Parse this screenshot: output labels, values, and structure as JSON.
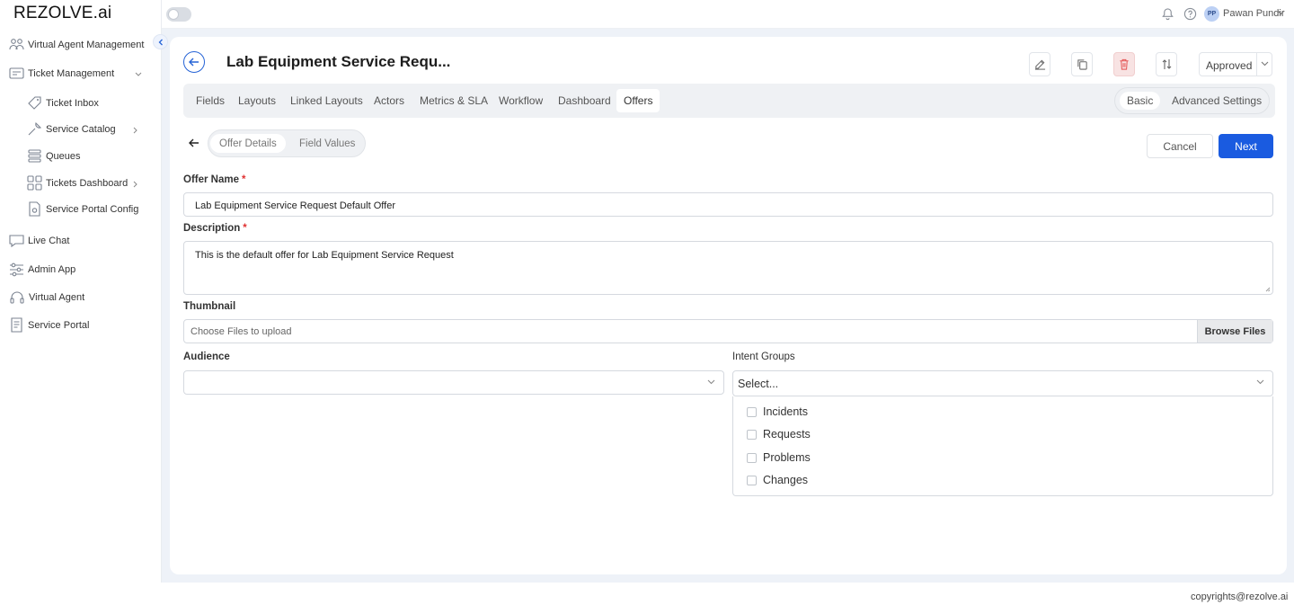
{
  "app": {
    "logo": "REZOLVE.ai"
  },
  "topbar": {
    "user_initials": "PP",
    "user_name": "Pawan Pundir"
  },
  "sidebar": {
    "items": [
      {
        "label": "Virtual Agent Management",
        "icon": "people-icon"
      },
      {
        "label": "Ticket Management",
        "icon": "ticket-board-icon"
      },
      {
        "label": "Ticket Inbox",
        "icon": "tag-icon"
      },
      {
        "label": "Service Catalog",
        "icon": "wrench-icon"
      },
      {
        "label": "Queues",
        "icon": "stack-icon"
      },
      {
        "label": "Tickets Dashboard",
        "icon": "grid-icon"
      },
      {
        "label": "Service Portal Config",
        "icon": "file-gear-icon"
      },
      {
        "label": "Live Chat",
        "icon": "chat-icon"
      },
      {
        "label": "Admin App",
        "icon": "sliders-icon"
      },
      {
        "label": "Virtual Agent",
        "icon": "headset-icon"
      },
      {
        "label": "Service Portal",
        "icon": "document-icon"
      }
    ]
  },
  "header": {
    "title": "Lab Equipment Service Requ...",
    "status": "Approved"
  },
  "tabs": [
    "Fields",
    "Layouts",
    "Linked Layouts",
    "Actors",
    "Metrics & SLA",
    "Workflow",
    "Dashboard",
    "Offers"
  ],
  "active_tab": "Offers",
  "settings_toggle": {
    "basic": "Basic",
    "advanced": "Advanced Settings"
  },
  "subtabs": {
    "details": "Offer Details",
    "values": "Field Values"
  },
  "actions": {
    "cancel": "Cancel",
    "next": "Next"
  },
  "form": {
    "offer_name_label": "Offer Name",
    "offer_name_value": "Lab Equipment Service Request Default Offer",
    "description_label": "Description",
    "description_value": "This is the default offer for Lab Equipment Service Request",
    "thumbnail_label": "Thumbnail",
    "thumbnail_placeholder": "Choose Files to upload",
    "browse_label": "Browse Files",
    "audience_label": "Audience",
    "audience_value": "",
    "intent_groups_label": "Intent Groups",
    "intent_groups_placeholder": "Select...",
    "intent_groups_options": [
      "Incidents",
      "Requests",
      "Problems",
      "Changes"
    ]
  },
  "required_marker": "*",
  "footer": {
    "copyright": "copyrights@rezolve.ai"
  },
  "colors": {
    "primary": "#1a5be0",
    "danger": "#e03131",
    "content_bg": "#eef2f8"
  }
}
